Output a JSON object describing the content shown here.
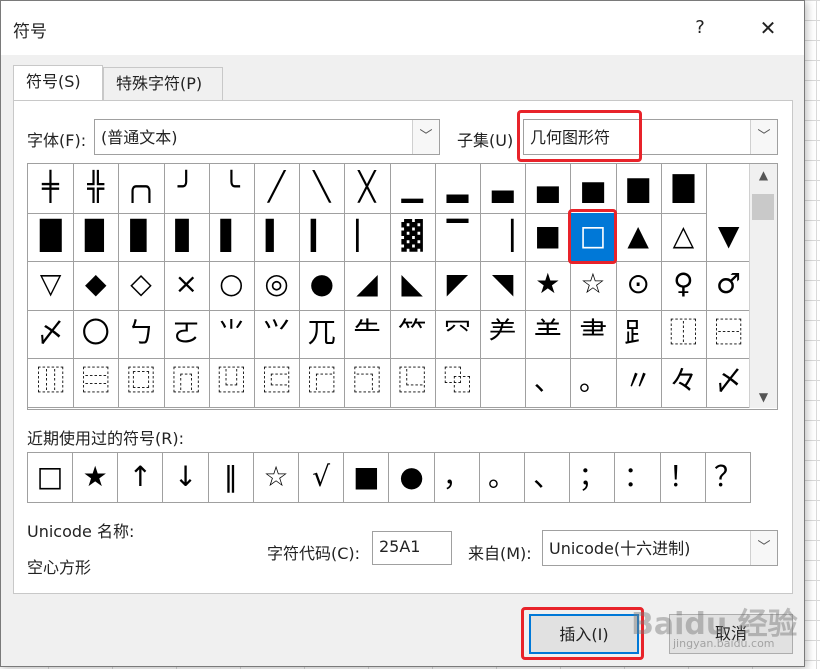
{
  "dialog": {
    "title": "符号",
    "help": "?",
    "close": "✕"
  },
  "tabs": [
    {
      "label": "符号(S)"
    },
    {
      "label": "特殊字符(P)"
    }
  ],
  "font": {
    "label": "字体(F):",
    "value": "(普通文本)"
  },
  "subset": {
    "label": "子集(U)",
    "value": "几何图形符"
  },
  "grid": {
    "rows": [
      [
        "╪",
        "╬",
        "╭╮",
        "╯",
        "╰",
        "╱",
        "╲",
        "╳",
        "▁",
        "▂",
        "▃",
        "▄",
        "▅",
        "▆",
        "▇"
      ],
      [
        "█",
        "▉",
        "▊",
        "▋",
        "▌",
        "▍",
        "▎",
        "▏",
        "▓",
        "▔",
        "▕",
        "■",
        "□",
        "▲",
        "△",
        "▼"
      ],
      [
        "▽",
        "◆",
        "◇",
        "×",
        "○",
        "◎",
        "●",
        "◢",
        "◣",
        "◤",
        "◥",
        "★",
        "☆",
        "⊙",
        "♀",
        "♂"
      ],
      [
        "〆",
        "〇",
        "ㄅ",
        "ㄛ",
        "⺌",
        "⺍",
        "⺎",
        "⺧",
        "⺮",
        "⺳",
        "⺶",
        "⺷",
        "⺻",
        "⻊",
        "⿰",
        "⿱"
      ],
      [
        "⿲",
        "⿳",
        "⿴",
        "⿵",
        "⿶",
        "⿷",
        "⿸",
        "⿹",
        "⿺",
        "⿻",
        "",
        "、",
        "。",
        "〃",
        "々",
        "〆"
      ]
    ],
    "selected": {
      "row": 1,
      "col": 12
    }
  },
  "recent": {
    "label": "近期使用过的符号(R):",
    "symbols": [
      "□",
      "★",
      "↑",
      "↓",
      "‖",
      "☆",
      "√",
      "■",
      "●",
      "，",
      "。",
      "、",
      "；",
      "：",
      "！",
      "？"
    ]
  },
  "unicode": {
    "name_label": "Unicode 名称:",
    "name_value": "空心方形"
  },
  "charcode": {
    "label": "字符代码(C):",
    "value": "25A1"
  },
  "from": {
    "label": "来自(M):",
    "value": "Unicode(十六进制)"
  },
  "buttons": {
    "insert": "插入(I)",
    "cancel": "取消"
  },
  "watermark": {
    "text": "Baidu 经验",
    "sub": "jingyan.baidu.com"
  },
  "colors": {
    "highlight": "#e8232a",
    "selection": "#0078d7"
  }
}
